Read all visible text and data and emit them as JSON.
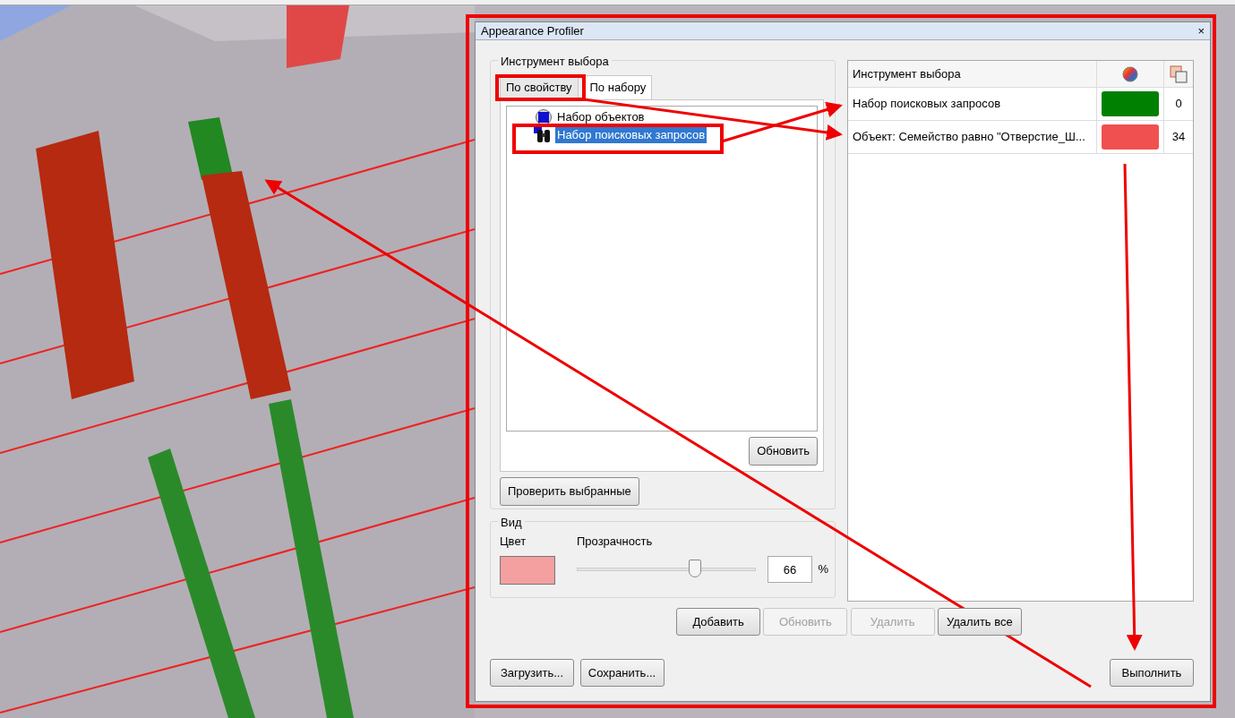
{
  "dialog": {
    "title": "Appearance Profiler",
    "close": "×"
  },
  "selector": {
    "legend": "Инструмент выбора",
    "tabs": [
      {
        "label": "По свойству",
        "selected": false
      },
      {
        "label": "По набору",
        "selected": true
      }
    ],
    "tree": [
      {
        "label": "Набор объектов",
        "kind": "objects",
        "selected": false
      },
      {
        "label": "Набор поисковых запросов",
        "kind": "search",
        "selected": true
      }
    ],
    "refresh_button": "Обновить",
    "check_button": "Проверить выбранные"
  },
  "view": {
    "legend": "Вид",
    "color_label": "Цвет",
    "color": "#f4a0a0",
    "transparency_label": "Прозрачность",
    "transparency": {
      "level": 0.66
    },
    "value": "66",
    "unit": "%"
  },
  "profile_table": {
    "columns": [
      "Инструмент выбора"
    ],
    "rows": [
      {
        "name": "Набор поисковых запросов",
        "color": "#008000",
        "count": "0"
      },
      {
        "name": "Объект: Семейство равно \"Отверстие_Ш...",
        "color": "#f05050",
        "count": "34"
      }
    ]
  },
  "buttons": [
    {
      "label": "Добавить",
      "disabled": false
    },
    {
      "label": "Обновить",
      "disabled": true
    },
    {
      "label": "Удалить",
      "disabled": true
    },
    {
      "label": "Удалить все",
      "disabled": false
    }
  ],
  "footer_buttons": [
    {
      "label": "Загрузить..."
    },
    {
      "label": "Сохранить..."
    }
  ],
  "run_button": "Выполнить"
}
